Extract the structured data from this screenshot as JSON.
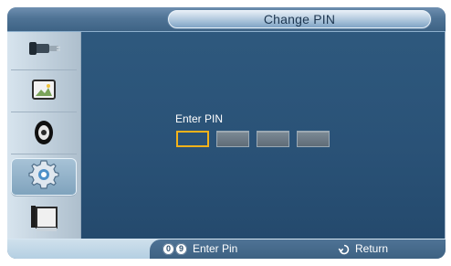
{
  "window": {
    "title": "Change PIN"
  },
  "sidebar": {
    "items": [
      {
        "icon": "input-source-icon",
        "selected": false
      },
      {
        "icon": "picture-icon",
        "selected": false
      },
      {
        "icon": "sound-icon",
        "selected": false
      },
      {
        "icon": "setup-gear-icon",
        "selected": true
      },
      {
        "icon": "multi-control-icon",
        "selected": false
      }
    ]
  },
  "pin": {
    "label": "Enter PIN",
    "digits": 4,
    "active_index": 0
  },
  "footer": {
    "enter_hint_badges": [
      "0",
      "9"
    ],
    "enter_hint_label": "Enter Pin",
    "return_label": "Return"
  },
  "colors": {
    "accent_focus": "#f4b21a",
    "panel_blue": "#2f5a7f",
    "sidebar_bg": "#d7e4ee"
  }
}
